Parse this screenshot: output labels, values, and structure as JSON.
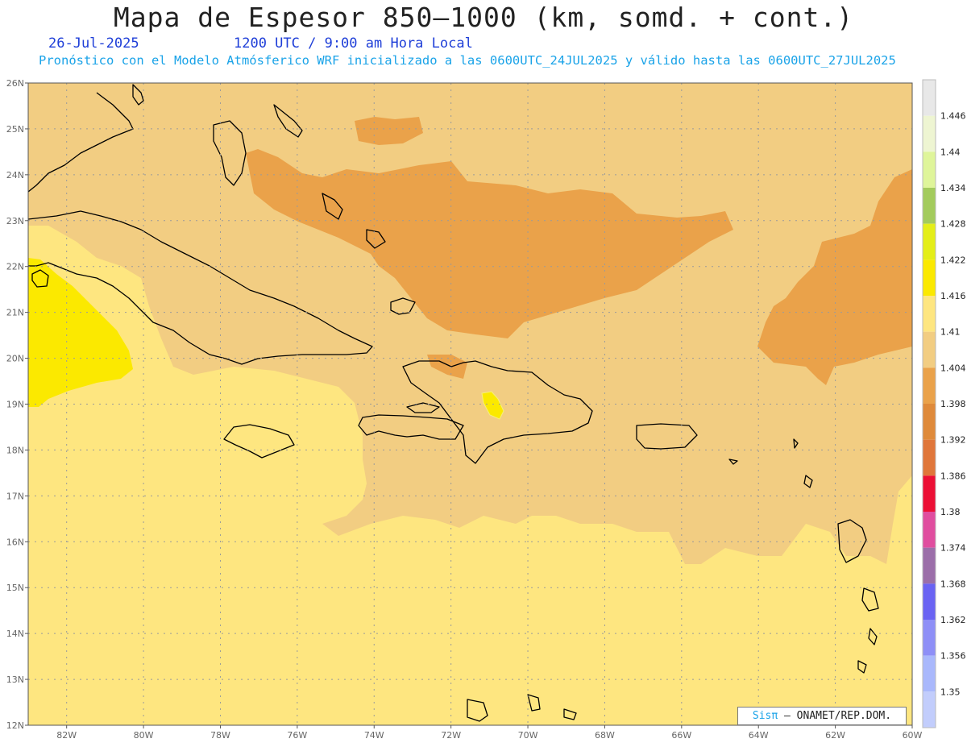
{
  "header": {
    "title": "Mapa de Espesor 850—1000 (km, somd. + cont.)",
    "date": "26-Jul-2025",
    "time": "1200 UTC / 9:00 am Hora Local",
    "forecast": "Pronóstico con el Modelo Atmósferico WRF inicializado a las 0600UTC_24JUL2025 y válido hasta las  0600UTC_27JUL2025"
  },
  "map": {
    "lat_labels": [
      "26N",
      "25N",
      "24N",
      "23N",
      "22N",
      "21N",
      "20N",
      "19N",
      "18N",
      "17N",
      "16N",
      "15N",
      "14N",
      "13N",
      "12N"
    ],
    "lon_labels": [
      "82W",
      "80W",
      "78W",
      "76W",
      "74W",
      "72W",
      "70W",
      "68W",
      "66W",
      "64W",
      "62W",
      "60W"
    ],
    "colors": {
      "c1410": "#fee680",
      "c1404": "#f2cd82",
      "c1398": "#eaa24a",
      "c1416": "#fbe900",
      "c1392": "#df8a3a"
    }
  },
  "colorbar": {
    "labels": [
      "1.446",
      "1.44",
      "1.434",
      "1.428",
      "1.422",
      "1.416",
      "1.41",
      "1.404",
      "1.398",
      "1.392",
      "1.386",
      "1.38",
      "1.374",
      "1.368",
      "1.362",
      "1.356",
      "1.35"
    ],
    "colors": [
      "#e8e8e8",
      "#eef5d2",
      "#dff59a",
      "#a3cb5c",
      "#e4ee18",
      "#fbe900",
      "#fee680",
      "#f2cd82",
      "#eaa24a",
      "#df8a3a",
      "#e0763a",
      "#ec0f35",
      "#e04d9f",
      "#9b6ea9",
      "#6a63f3",
      "#8e8ff7",
      "#a9b8fc",
      "#c2cdfc"
    ]
  },
  "credit": {
    "sis": "Sisπ",
    "text": " – ONAMET/REP.DOM."
  }
}
